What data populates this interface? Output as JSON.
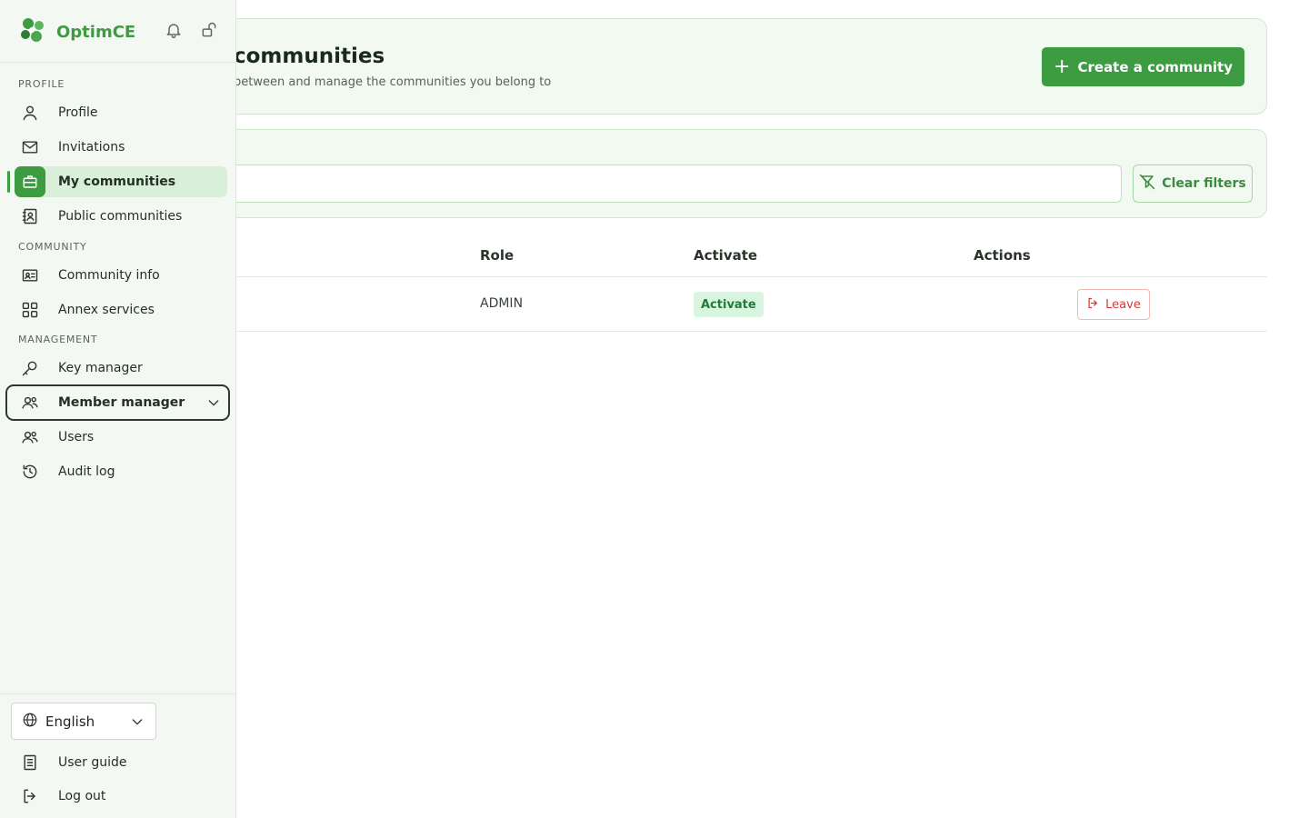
{
  "brand": {
    "name": "OptimCE"
  },
  "header": {
    "title": "communities",
    "subtitle": "between and manage the communities you belong to",
    "create_label": "Create a community"
  },
  "filters": {
    "search_value": "",
    "clear_label": "Clear filters"
  },
  "table": {
    "columns": {
      "role": "Role",
      "activate": "Activate",
      "actions": "Actions"
    },
    "rows": [
      {
        "role": "ADMIN",
        "activate_badge": "Activate",
        "leave_label": "Leave"
      }
    ]
  },
  "sidebar": {
    "sections": {
      "profile": "PROFILE",
      "community": "COMMUNITY",
      "management": "MANAGEMENT"
    },
    "items": {
      "profile": "Profile",
      "invitations": "Invitations",
      "my_communities": "My communities",
      "public_communities": "Public communities",
      "community_info": "Community info",
      "annex_services": "Annex services",
      "key_manager": "Key manager",
      "member_manager": "Member manager",
      "users": "Users",
      "audit_log": "Audit log"
    },
    "language": "English",
    "user_guide": "User guide",
    "logout": "Log out"
  },
  "colors": {
    "accent": "#3d9b42",
    "card_bg": "#f1f9f1",
    "danger": "#d23b3b",
    "badge_bg": "#d8f5df"
  }
}
